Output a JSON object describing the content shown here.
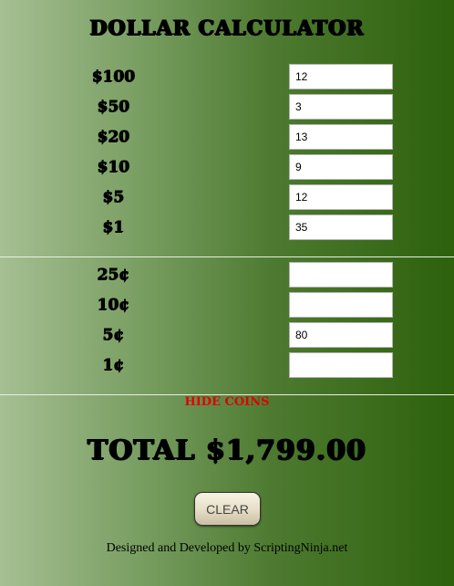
{
  "title": "DOLLAR CALCULATOR",
  "bills": [
    {
      "label": "$100",
      "value": "12"
    },
    {
      "label": "$50",
      "value": "3"
    },
    {
      "label": "$20",
      "value": "13"
    },
    {
      "label": "$10",
      "value": "9"
    },
    {
      "label": "$5",
      "value": "12"
    },
    {
      "label": "$1",
      "value": "35"
    }
  ],
  "coins": [
    {
      "label": "25¢",
      "value": ""
    },
    {
      "label": "10¢",
      "value": ""
    },
    {
      "label": "5¢",
      "value": "80"
    },
    {
      "label": "1¢",
      "value": ""
    }
  ],
  "toggle_coins_label": "HIDE COINS",
  "total": "TOTAL $1,799.00",
  "clear_label": "CLEAR",
  "footer": "Designed and Developed by ScriptingNinja.net",
  "colors": {
    "background_light": "#a6bf93",
    "background_dark": "#2d610c",
    "toggle_text": "#e00000"
  }
}
